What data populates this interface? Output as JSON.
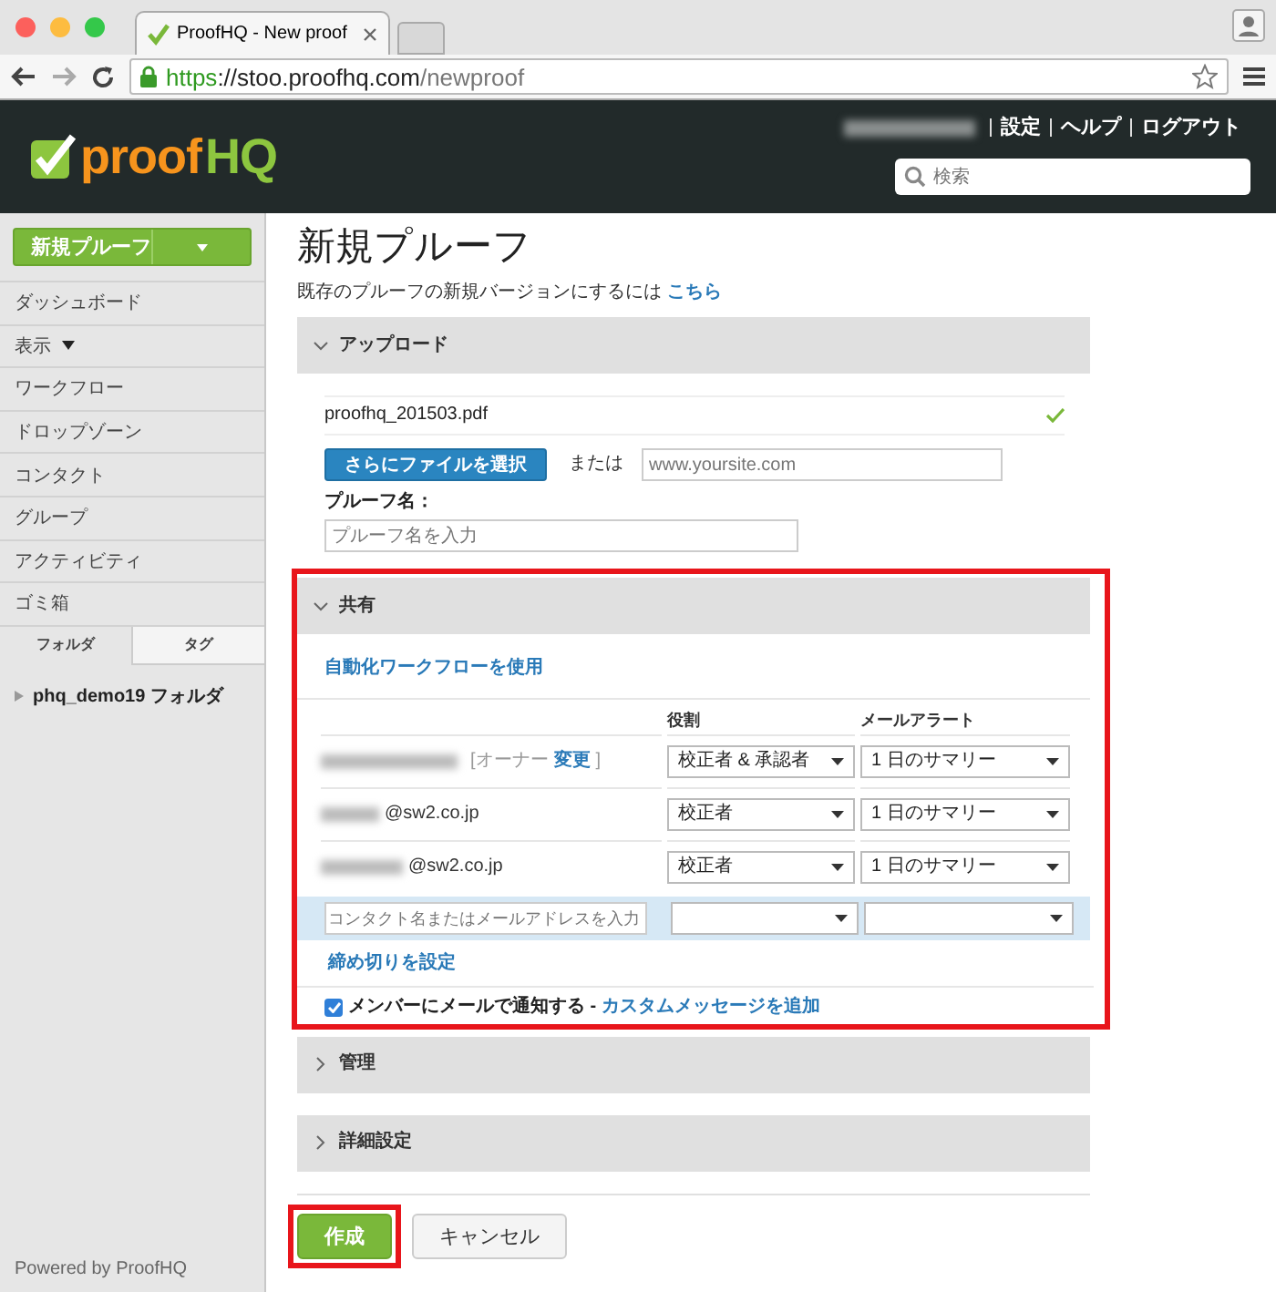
{
  "browser": {
    "tab_title": "ProofHQ - New proof",
    "url_parts": [
      "https",
      "://stoo.proofhq.com",
      "/newproof"
    ]
  },
  "header": {
    "logo": [
      "proof",
      "HQ"
    ],
    "links": [
      "設定",
      "ヘルプ",
      "ログアウト"
    ],
    "search": {
      "placeholder": "検索"
    }
  },
  "sidebar": {
    "new_button": "新規プルーフ",
    "items": [
      {
        "label": "ダッシュボード",
        "kind": "link"
      },
      {
        "label": "表示",
        "kind": "dropdown"
      },
      {
        "label": "ワークフロー",
        "kind": "link"
      },
      {
        "label": "ドロップゾーン",
        "kind": "link"
      },
      {
        "label": "コンタクト",
        "kind": "link"
      },
      {
        "label": "グループ",
        "kind": "link"
      },
      {
        "label": "アクティビティ",
        "kind": "link"
      },
      {
        "label": "ゴミ箱",
        "kind": "link"
      }
    ],
    "tabs": [
      {
        "label": "フォルダ",
        "selected": true
      },
      {
        "label": "タグ",
        "selected": false
      }
    ],
    "folders": [
      {
        "label": "phq_demo19 フォルダ",
        "expanded": false
      }
    ],
    "footer": "Powered by ProofHQ"
  },
  "main": {
    "title": "新規プルーフ",
    "hint": "既存のプルーフの新規バージョンにするには",
    "hint_link": "こちら",
    "sections": [
      {
        "kind": "upload",
        "title": "アップロード",
        "expanded": true,
        "file": "proofhq_201503.pdf",
        "uploaded": true,
        "select_button": "さらにファイルを選択",
        "or": "または",
        "url_placeholder": "www.yoursite.com",
        "name_label": "プルーフ名：",
        "name_placeholder": "プルーフ名を入力"
      },
      {
        "kind": "share",
        "title": "共有",
        "expanded": true,
        "highlighted": true,
        "workflow_link": "自動化ワークフローを使用",
        "columns": [
          "役割",
          "メールアラート"
        ],
        "members": [
          {
            "kind": "owner",
            "owner_label": "[オーナー",
            "change_link": "変更",
            "close": "]",
            "role": "校正者 & 承認者",
            "alert": "1 日のサマリー"
          },
          {
            "kind": "email",
            "domain": "@sw2.co.jp",
            "role": "校正者",
            "alert": "1 日のサマリー"
          },
          {
            "kind": "email",
            "domain": "@sw2.co.jp",
            "role": "校正者",
            "alert": "1 日のサマリー"
          }
        ],
        "contact_placeholder": "コンタクト名またはメールアドレスを入力",
        "deadline_link": "締め切りを設定",
        "notify": {
          "checked": true,
          "label": "メンバーにメールで通知する -",
          "link": "カスタムメッセージを追加"
        }
      },
      {
        "kind": "plain",
        "title": "管理",
        "expanded": false
      },
      {
        "kind": "plain",
        "title": "詳細設定",
        "expanded": false
      }
    ],
    "buttons": [
      {
        "label": "作成",
        "kind": "primary",
        "highlighted": true
      },
      {
        "label": "キャンセル",
        "kind": "secondary",
        "highlighted": false
      }
    ]
  }
}
